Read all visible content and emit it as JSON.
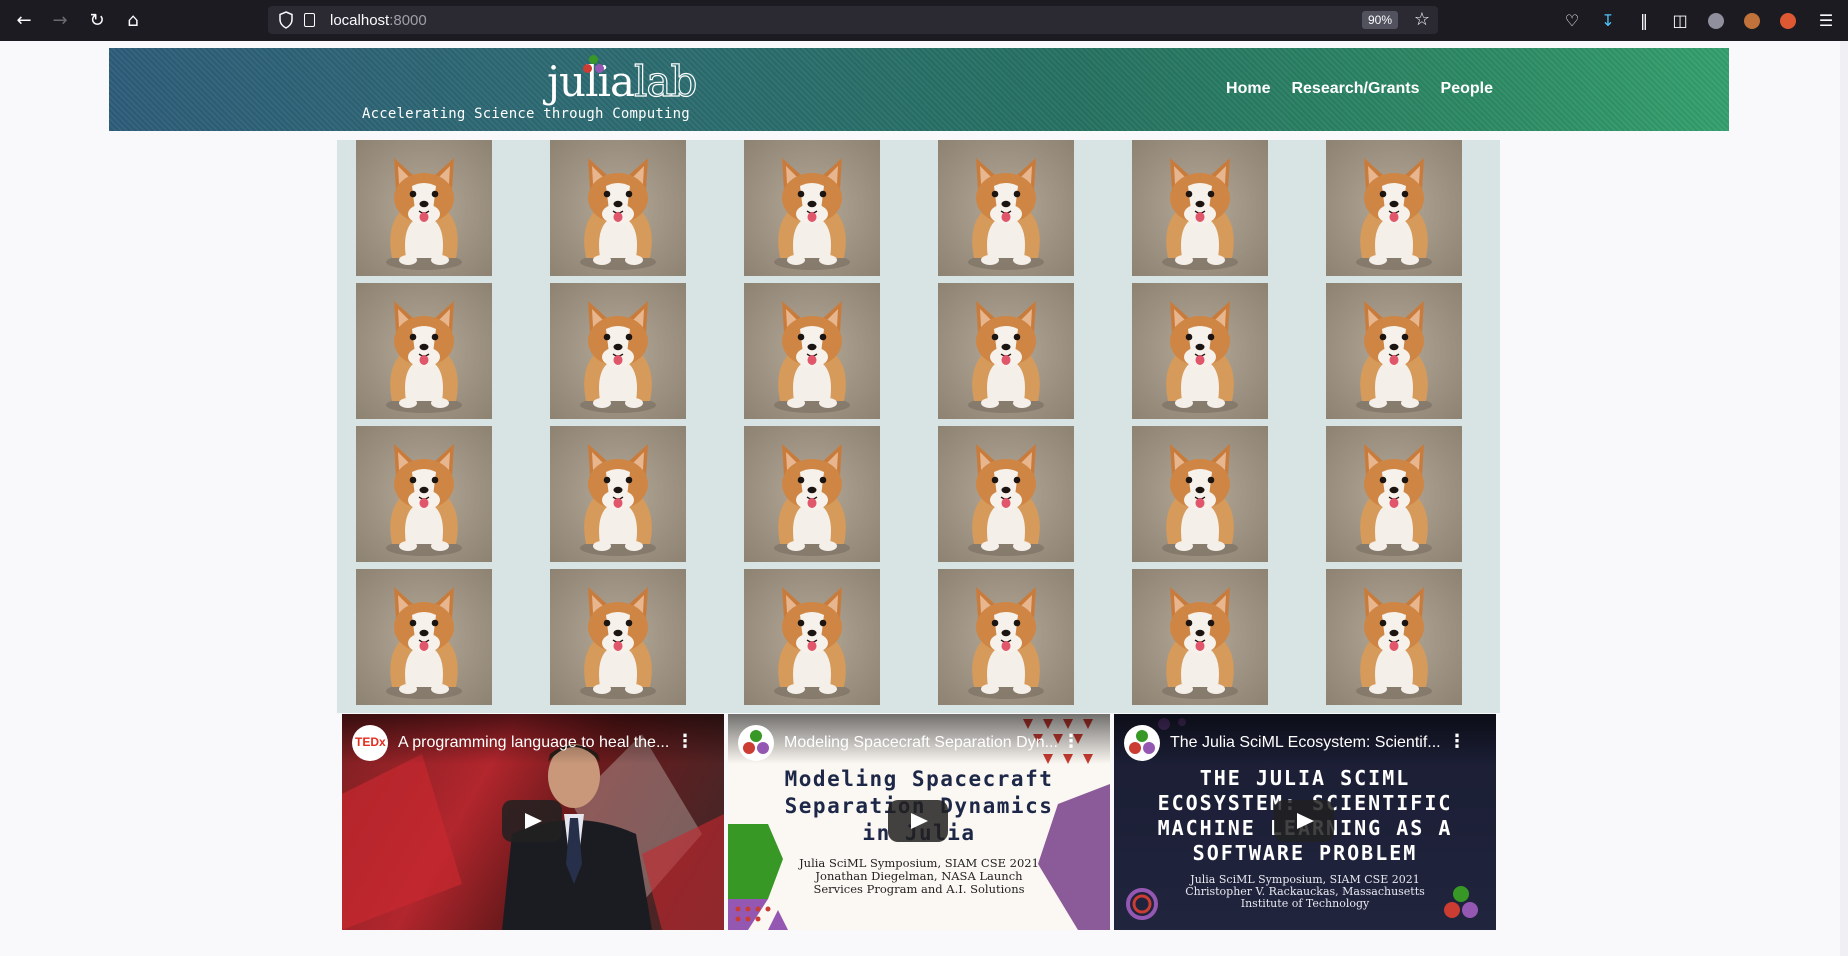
{
  "browser": {
    "url_host": "localhost",
    "url_port": ":8000",
    "zoom": "90%"
  },
  "site": {
    "logo_text_julia": "julia",
    "logo_text_lab": "lab",
    "tagline": "Accelerating Science through Computing",
    "nav": [
      {
        "label": "Home"
      },
      {
        "label": "Research/Grants"
      },
      {
        "label": "People"
      }
    ]
  },
  "gallery": {
    "rows": 4,
    "cols": 6,
    "image_alt": "corgi"
  },
  "videos": [
    {
      "title": "A programming language to heal the...",
      "channel_badge": "TEDx"
    },
    {
      "title": "Modeling Spacecraft Separation Dyn...",
      "slide_title": "Modeling Spacecraft Separation Dynamics in Julia",
      "slide_line1": "Julia SciML Symposium, SIAM CSE 2021",
      "slide_line2": "Jonathan Diegelman, NASA Launch",
      "slide_line3": "Services Program and A.I. Solutions"
    },
    {
      "title": "The Julia SciML Ecosystem: Scientif...",
      "slide_title": "THE JULIA SCIML ECOSYSTEM: SCIENTIFIC MACHINE LEARNING AS A SOFTWARE PROBLEM",
      "slide_line1": "Julia SciML Symposium, SIAM CSE 2021",
      "slide_line2": "Christopher V. Rackauckas, Massachusetts",
      "slide_line3": "Institute of Technology"
    }
  ],
  "colors": {
    "julia_red": "#cb3c33",
    "julia_green": "#389826",
    "julia_purple": "#9558b2",
    "gallery_bg": "#d8e4e3"
  }
}
